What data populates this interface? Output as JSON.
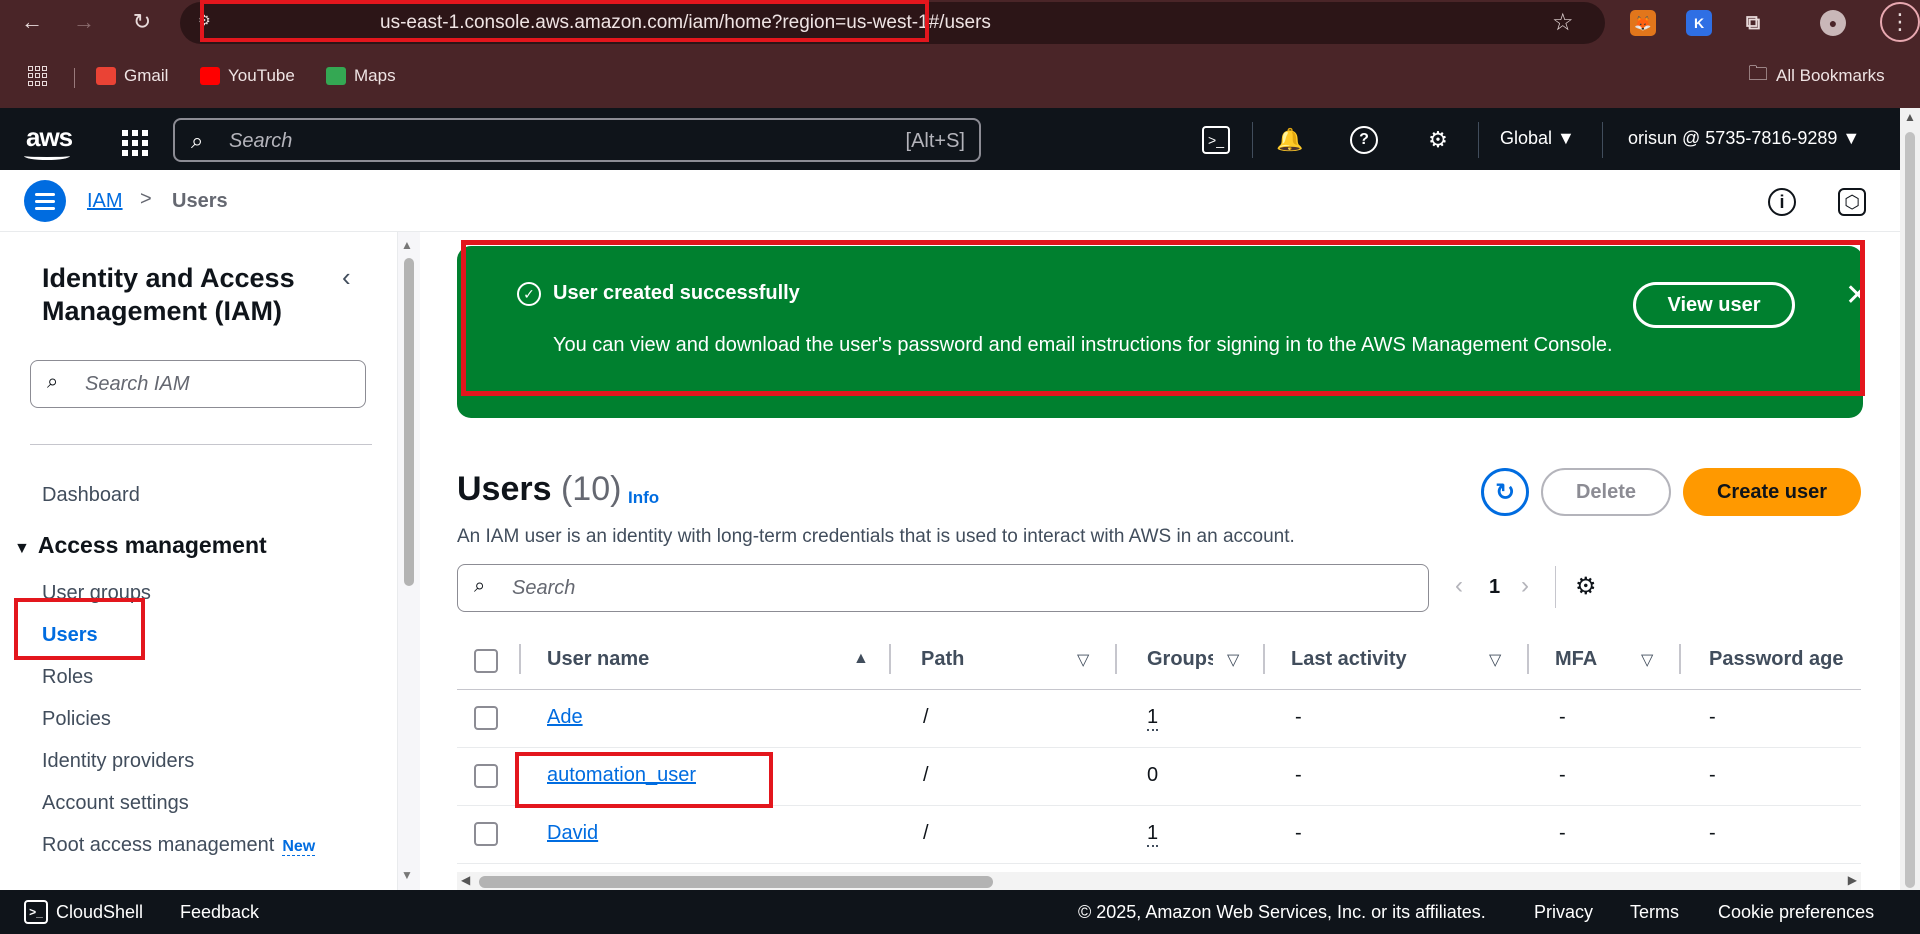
{
  "browser": {
    "url": "us-east-1.console.aws.amazon.com/iam/home?region=us-west-1#/users",
    "bookmarks": [
      {
        "label": "Gmail",
        "color": "#ea4335"
      },
      {
        "label": "YouTube",
        "color": "#ff0000"
      },
      {
        "label": "Maps",
        "color": "#34a853"
      }
    ],
    "all_bookmarks": "All Bookmarks"
  },
  "aws_header": {
    "logo": "aws",
    "search_placeholder": "Search",
    "search_shortcut": "[Alt+S]",
    "region": "Global ▼",
    "account": "orisun @ 5735-7816-9289 ▼"
  },
  "breadcrumb": {
    "root": "IAM",
    "separator": ">",
    "current": "Users"
  },
  "sidebar": {
    "title": "Identity and Access Management (IAM)",
    "search_placeholder": "Search IAM",
    "dashboard": "Dashboard",
    "section": "Access management",
    "items": [
      {
        "label": "User groups"
      },
      {
        "label": "Users"
      },
      {
        "label": "Roles"
      },
      {
        "label": "Policies"
      },
      {
        "label": "Identity providers"
      },
      {
        "label": "Account settings"
      },
      {
        "label": "Root access management",
        "badge": "New"
      }
    ]
  },
  "flash": {
    "title": "User created successfully",
    "body": "You can view and download the user's password and email instructions for signing in to the AWS Management Console.",
    "button": "View user",
    "color": "#00802f"
  },
  "users": {
    "title": "Users",
    "count": "(10)",
    "info": "Info",
    "description": "An IAM user is an identity with long-term credentials that is used to interact with AWS in an account.",
    "delete_label": "Delete",
    "create_label": "Create user",
    "search_placeholder": "Search",
    "page": "1",
    "columns": [
      "User name",
      "Path",
      "Groups",
      "Last activity",
      "MFA",
      "Password age"
    ],
    "rows": [
      {
        "name": "Ade",
        "path": "/",
        "groups": "1",
        "last_activity": "-",
        "mfa": "-",
        "password_age": "-"
      },
      {
        "name": "automation_user",
        "path": "/",
        "groups": "0",
        "last_activity": "-",
        "mfa": "-",
        "password_age": "-"
      },
      {
        "name": "David",
        "path": "/",
        "groups": "1",
        "last_activity": "-",
        "mfa": "-",
        "password_age": "-"
      }
    ]
  },
  "footer": {
    "cloudshell": "CloudShell",
    "feedback": "Feedback",
    "copyright": "© 2025, Amazon Web Services, Inc. or its affiliates.",
    "privacy": "Privacy",
    "terms": "Terms",
    "cookie": "Cookie preferences"
  },
  "colors": {
    "accent": "#006ce0",
    "primary_button": "#ff9900",
    "annotation": "#e3161d"
  }
}
